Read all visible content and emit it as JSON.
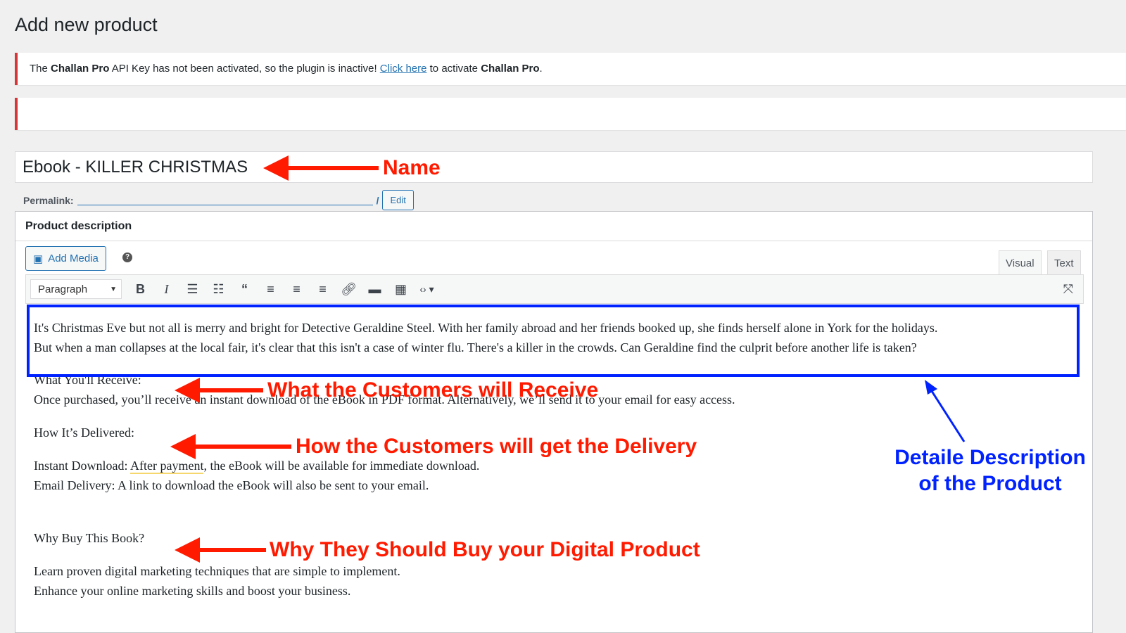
{
  "page_title": "Add new product",
  "notice": {
    "pre": "The ",
    "brand1": "Challan Pro",
    "mid": " API Key has not been activated, so the plugin is inactive! ",
    "link": "Click here",
    "post": " to activate ",
    "brand2": "Challan Pro",
    "end": "."
  },
  "product_title": "Ebook - KILLER CHRISTMAS",
  "permalink": {
    "label": "Permalink:",
    "edit": "Edit"
  },
  "description": {
    "heading": "Product description",
    "add_media": "Add Media",
    "help": "?",
    "tabs": {
      "visual": "Visual",
      "text": "Text"
    },
    "format": "Paragraph"
  },
  "toolbar": [
    "bold-icon",
    "italic-icon",
    "bullet-list-icon",
    "numbered-list-icon",
    "blockquote-icon",
    "align-left-icon",
    "align-center-icon",
    "align-right-icon",
    "link-icon",
    "read-more-icon",
    "toolbar-toggle-icon",
    "code-icon",
    "fullscreen-icon"
  ],
  "body": {
    "p1a": "It's Christmas Eve but not all is merry and bright for Detective Geraldine Steel. With her family abroad and her friends booked up, she finds herself alone in York for the holidays.",
    "p1b": "But when a man collapses at the local fair, it's clear that this isn't a case of winter flu. There's a killer in the crowds. Can Geraldine find the culprit before another life is taken?",
    "h1": "What You'll Receive:",
    "p2": "Once purchased, you’ll receive an instant download of the eBook in PDF format. Alternatively, we’ll send it to your email for easy access.",
    "h2": "How It’s Delivered:",
    "p3pre": "Instant Download: ",
    "p3hl": "After payment",
    "p3post": ", the eBook will be available for immediate download.",
    "p4": "Email Delivery: A link to download the eBook will also be sent to your email.",
    "h3": "Why Buy This Book?",
    "p5": "Learn proven digital marketing techniques that are simple to implement.",
    "p6": "Enhance your online marketing skills and boost your business."
  },
  "annotations": {
    "name": "Name",
    "receive": "What the Customers will Receive",
    "delivery": "How the Customers will get the Delivery",
    "buy": "Why They Should Buy your Digital Product",
    "detail1": "Detaile Description",
    "detail2": "of the Product"
  },
  "colors": {
    "annotation_red": "#ff1a00",
    "annotation_blue": "#0022ff",
    "notice_border": "#d63638",
    "link": "#2271b1"
  }
}
